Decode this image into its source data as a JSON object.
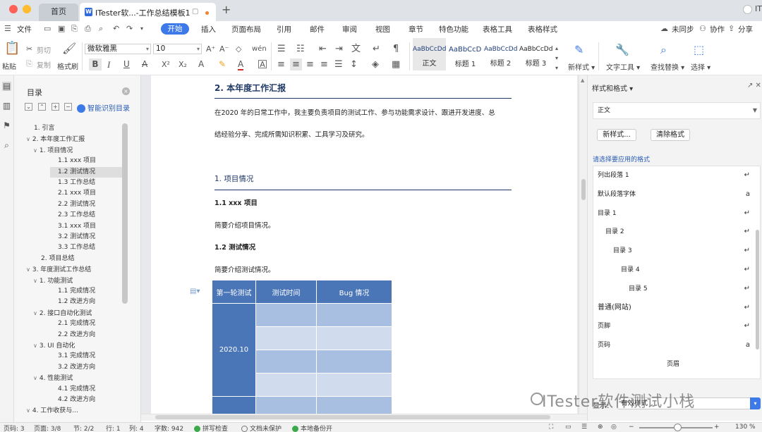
{
  "window": {
    "home_tab": "首页",
    "doc_tab": "ITester软...-工作总结模板1",
    "new_tab": "+",
    "user_mark": "IT",
    "traffic_colors": [
      "#fe5f57",
      "#febc2e",
      "#28c840"
    ]
  },
  "menu": {
    "file": "文件",
    "items": [
      "开始",
      "插入",
      "页面布局",
      "引用",
      "邮件",
      "审阅",
      "视图",
      "章节",
      "特色功能",
      "表格工具",
      "表格样式"
    ],
    "right": [
      "未同步",
      "协作",
      "分享"
    ],
    "accent": "#3d7ae8"
  },
  "ribbon": {
    "paste": "粘贴",
    "cut": "剪切",
    "copy": "复制",
    "format_painter": "格式刷",
    "font_name": "微软雅黑",
    "font_size": "10",
    "styles": [
      {
        "preview": "AaBbCcDd",
        "name": "正文"
      },
      {
        "preview": "AaBbCcDd",
        "name": "标题 1"
      },
      {
        "preview": "AaBbCcDd",
        "name": "标题 2"
      },
      {
        "preview": "AaBbCcDd",
        "name": "标题 3"
      }
    ],
    "new_style": "新样式",
    "text_tools": "文字工具",
    "find_replace": "查找替换",
    "select": "选择"
  },
  "toc": {
    "title": "目录",
    "smart": "智能识别目录",
    "items": [
      {
        "label": "1. 引言",
        "level": 1,
        "toggle": ""
      },
      {
        "label": "2. 本年度工作汇报",
        "level": 1,
        "toggle": "∨"
      },
      {
        "label": "1. 项目情况",
        "level": 2,
        "toggle": "∨"
      },
      {
        "label": "1.1 xxx 项目",
        "level": 3,
        "toggle": ""
      },
      {
        "label": "1.2 测试情况",
        "level": 3,
        "toggle": ""
      },
      {
        "label": "1.3 工作总结",
        "level": 3,
        "toggle": ""
      },
      {
        "label": "2.1 xxx 项目",
        "level": 3,
        "toggle": ""
      },
      {
        "label": "2.2 测试情况",
        "level": 3,
        "toggle": ""
      },
      {
        "label": "2.3 工作总结",
        "level": 3,
        "toggle": ""
      },
      {
        "label": "3.1 xxx 项目",
        "level": 3,
        "toggle": ""
      },
      {
        "label": "3.2 测试情况",
        "level": 3,
        "toggle": ""
      },
      {
        "label": "3.3 工作总结",
        "level": 3,
        "toggle": ""
      },
      {
        "label": "2. 项目总结",
        "level": 2,
        "toggle": ""
      },
      {
        "label": "3. 年度测试工作总结",
        "level": 1,
        "toggle": "∨"
      },
      {
        "label": "1. 功能测试",
        "level": 2,
        "toggle": "∨"
      },
      {
        "label": "1.1 完成情况",
        "level": 3,
        "toggle": ""
      },
      {
        "label": "1.2 改进方向",
        "level": 3,
        "toggle": ""
      },
      {
        "label": "2. 接口自动化测试",
        "level": 2,
        "toggle": "∨"
      },
      {
        "label": "2.1 完成情况",
        "level": 3,
        "toggle": ""
      },
      {
        "label": "2.2 改进方向",
        "level": 3,
        "toggle": ""
      },
      {
        "label": "3. UI 自动化",
        "level": 2,
        "toggle": "∨"
      },
      {
        "label": "3.1 完成情况",
        "level": 3,
        "toggle": ""
      },
      {
        "label": "3.2 改进方向",
        "level": 3,
        "toggle": ""
      },
      {
        "label": "4. 性能测试",
        "level": 2,
        "toggle": "∨"
      },
      {
        "label": "4.1 完成情况",
        "level": 3,
        "toggle": ""
      },
      {
        "label": "4.2 改进方向",
        "level": 3,
        "toggle": ""
      },
      {
        "label": "4. 工作收获与...",
        "level": 1,
        "toggle": "∨"
      }
    ],
    "selected_index": 4
  },
  "document": {
    "heading2": "2. 本年度工作汇报",
    "para1": "在2020 年的日常工作中，我主要负责项目的测试工作、参与功能需求设计、跟进开发进度、总",
    "para2": "结经验分享、完成所需知识积累、工具学习及研究。",
    "sub_heading": "1. 项目情况",
    "h_1_1": "1.1 xxx 项目",
    "p_1_1": "简要介绍项目情况。",
    "h_1_2": "1.2  测试情况",
    "p_1_2": "简要介绍测试情况。",
    "table": {
      "headers": [
        "第一轮测试",
        "测试时间",
        "Bug 情况"
      ],
      "row_header": "2020.10"
    },
    "header_color": "#4a76b8"
  },
  "styles_panel": {
    "title": "样式和格式",
    "current": "正文",
    "new_style_btn": "新样式...",
    "clear_btn": "清除格式",
    "hint": "请选择要应用的格式",
    "list": [
      {
        "name": "列出段落 1",
        "mark": "↵",
        "indent": 0
      },
      {
        "name": "默认段落字体",
        "mark": "a",
        "indent": 0
      },
      {
        "name": "目录 1",
        "mark": "↵",
        "indent": 0
      },
      {
        "name": "目录 2",
        "mark": "↵",
        "indent": 1
      },
      {
        "name": "目录 3",
        "mark": "↵",
        "indent": 2
      },
      {
        "name": "目录 4",
        "mark": "↵",
        "indent": 3
      },
      {
        "name": "目录 5",
        "mark": "↵",
        "indent": 4
      },
      {
        "name": "普通(网站)",
        "mark": "↵",
        "indent": 0
      },
      {
        "name": "页脚",
        "mark": "↵",
        "indent": 0
      },
      {
        "name": "页码",
        "mark": "a",
        "indent": 0
      },
      {
        "name": "页眉",
        "mark": "↵",
        "indent": 5
      }
    ],
    "show_label": "显示:",
    "show_value": "有效样式"
  },
  "watermark": "ITester软件测试小栈",
  "status": {
    "page_num": "页码: 3",
    "pages": "页面: 3/8",
    "section": "节: 2/2",
    "row": "行: 1",
    "col": "列: 4",
    "words": "字数: 942",
    "spell": "拼写检查",
    "protect": "文档未保护",
    "backup": "本地备份开",
    "zoom": "130 %",
    "zoom_fraction": 0.52
  }
}
